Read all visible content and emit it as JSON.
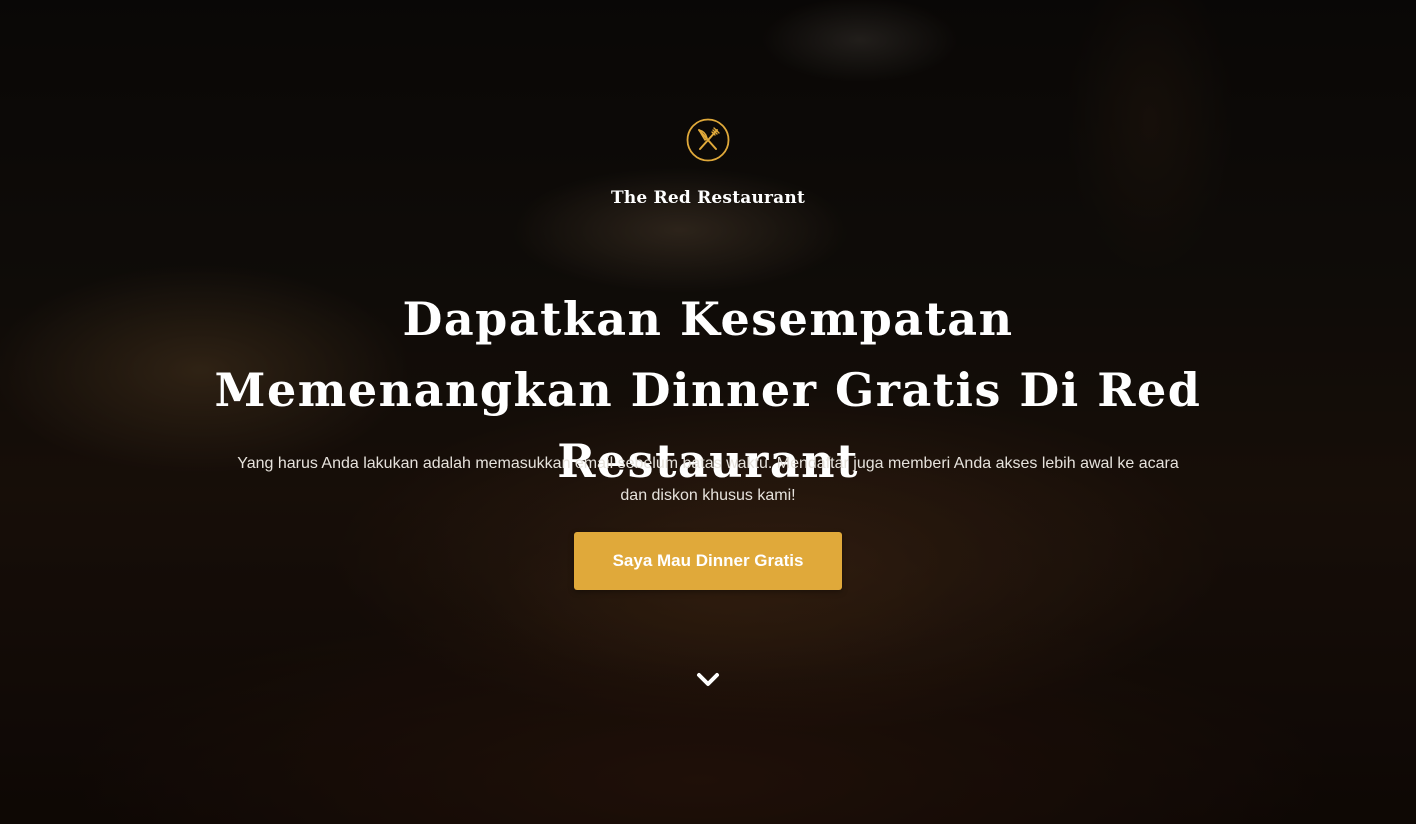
{
  "brand": {
    "name": "The Red Restaurant",
    "logo_icon": "fork-knife-icon",
    "accent_color": "#e0a93a"
  },
  "hero": {
    "headline": "Dapatkan Kesempatan Memenangkan Dinner Gratis Di Red Restaurant",
    "subtext": "Yang harus Anda lakukan adalah memasukkan email sebelum batas waktu. Mendaftar juga memberi Anda akses lebih awal ke acara dan diskon khusus kami!",
    "cta_label": "Saya Mau Dinner Gratis",
    "scroll_icon": "chevron-down-icon"
  }
}
